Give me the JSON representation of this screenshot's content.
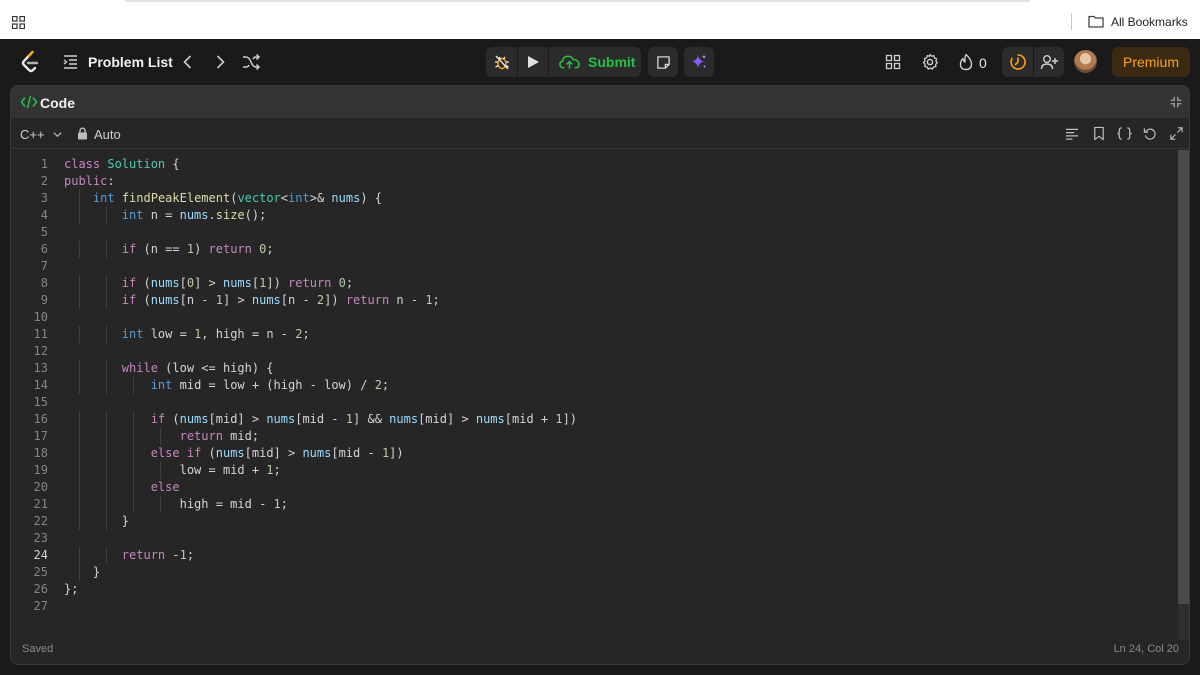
{
  "bookmarks_bar": {
    "all_bookmarks_label": "All Bookmarks"
  },
  "nav": {
    "problem_list_label": "Problem List",
    "submit_label": "Submit",
    "streak_count": "0",
    "premium_label": "Premium"
  },
  "panel": {
    "title": "Code",
    "language": "C++",
    "mode_label": "Auto",
    "status_saved": "Saved",
    "cursor_position": "Ln 24, Col 20"
  },
  "editor": {
    "active_line": 24,
    "lines": [
      "class Solution {",
      "public:",
      "    int findPeakElement(vector<int>& nums) {",
      "        int n = nums.size();",
      "",
      "        if (n == 1) return 0;",
      "",
      "        if (nums[0] > nums[1]) return 0;",
      "        if (nums[n - 1] > nums[n - 2]) return n - 1;",
      "",
      "        int low = 1, high = n - 2;",
      "",
      "        while (low <= high) {",
      "            int mid = low + (high - low) / 2;",
      "",
      "            if (nums[mid] > nums[mid - 1] && nums[mid] > nums[mid + 1])",
      "                return mid;",
      "            else if (nums[mid] > nums[mid - 1])",
      "                low = mid + 1;",
      "            else",
      "                high = mid - 1;",
      "        }",
      "",
      "        return -1;",
      "    }",
      "};",
      ""
    ]
  },
  "theme": {
    "accent_green": "#28c244",
    "premium_orange": "#ffa116",
    "ai_purple": "#8b5cf6"
  }
}
